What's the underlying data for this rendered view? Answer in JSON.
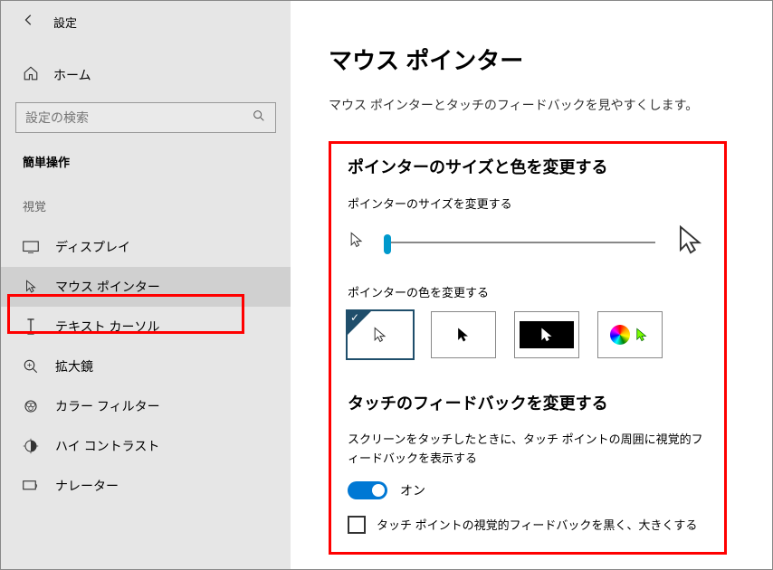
{
  "app_title": "設定",
  "home": "ホーム",
  "search_placeholder": "設定の検索",
  "section": "簡単操作",
  "group": "視覚",
  "nav": [
    "ディスプレイ",
    "マウス ポインター",
    "テキスト カーソル",
    "拡大鏡",
    "カラー フィルター",
    "ハイ コントラスト",
    "ナレーター"
  ],
  "page_title": "マウス ポインター",
  "page_sub": "マウス ポインターとタッチのフィードバックを見やすくします。",
  "sec1": "ポインターのサイズと色を変更する",
  "size_label": "ポインターのサイズを変更する",
  "color_label": "ポインターの色を変更する",
  "sec2": "タッチのフィードバックを変更する",
  "touch_desc": "スクリーンをタッチしたときに、タッチ ポイントの周囲に視覚的フィードバックを表示する",
  "toggle_on": "オン",
  "check_label": "タッチ ポイントの視覚的フィードバックを黒く、大きくする"
}
